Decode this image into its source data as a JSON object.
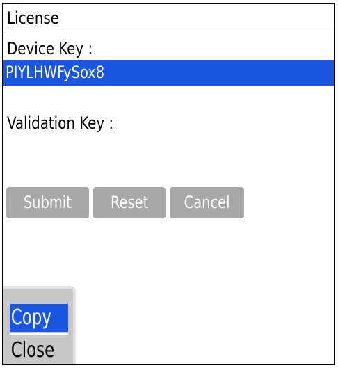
{
  "screen": {
    "title": "License"
  },
  "form": {
    "device_key_label": "Device Key :",
    "device_key_value": "PIYLHWFySox8",
    "validation_key_label": "Validation Key :",
    "validation_key_value": ""
  },
  "buttons": {
    "submit": "Submit",
    "reset": "Reset",
    "cancel": "Cancel"
  },
  "menu": {
    "items": [
      {
        "label": "Copy",
        "selected": true
      },
      {
        "label": "Close",
        "selected": false
      }
    ]
  },
  "colors": {
    "highlight": "#1b56e3",
    "button_disabled": "#a8a8a8",
    "menu_background": "#c8c8c8"
  }
}
